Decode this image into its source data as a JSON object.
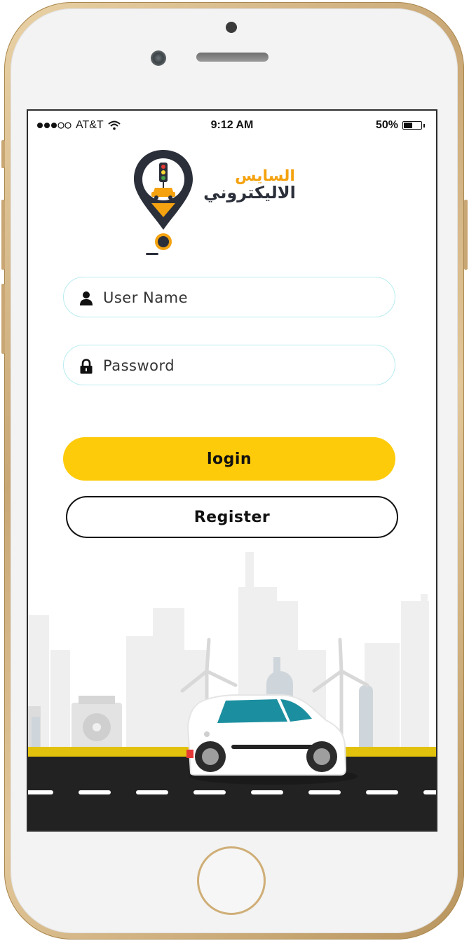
{
  "status_bar": {
    "carrier": "AT&T",
    "time": "9:12 AM",
    "battery": "50%",
    "battery_level": 0.5,
    "signal_bars_filled": 3,
    "signal_bars_total": 5
  },
  "brand": {
    "line1": "السايس",
    "line2": "الاليكتروني",
    "accent_color": "#f4a20f",
    "dark_color": "#2b2f3a"
  },
  "form": {
    "username_placeholder": "User Name",
    "username_value": "",
    "password_placeholder": "Password",
    "password_value": ""
  },
  "buttons": {
    "login_label": "login",
    "register_label": "Register"
  },
  "colors": {
    "primary": "#fecb0a",
    "input_border": "#b9ecf0",
    "car_window": "#1b8fa0",
    "road": "#222222",
    "road_edge": "#e2c10c"
  },
  "icons": {
    "username": "user-icon",
    "password": "lock-icon",
    "wifi": "wifi-icon",
    "battery": "battery-icon"
  }
}
